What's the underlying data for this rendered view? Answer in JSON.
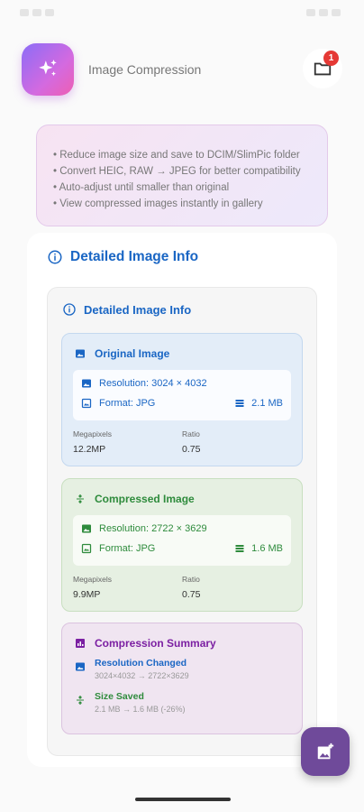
{
  "app": {
    "title": "Image Compression",
    "badge_count": "1"
  },
  "tips": [
    "• Reduce image size and save to DCIM/SlimPic folder",
    "• Convert HEIC, RAW → JPEG for better compatibility",
    "• Auto-adjust until smaller than original",
    "• View compressed images instantly in gallery"
  ],
  "outer": {
    "title": "Detailed Image Info"
  },
  "inner": {
    "title": "Detailed Image Info"
  },
  "original": {
    "title": "Original Image",
    "resolution": "Resolution: 3024 × 4032",
    "format": "Format: JPG",
    "size": "2.1 MB",
    "megapixels_label": "Megapixels",
    "megapixels": "12.2MP",
    "ratio_label": "Ratio",
    "ratio": "0.75"
  },
  "compressed": {
    "title": "Compressed Image",
    "resolution": "Resolution: 2722 × 3629",
    "format": "Format: JPG",
    "size": "1.6 MB",
    "megapixels_label": "Megapixels",
    "megapixels": "9.9MP",
    "ratio_label": "Ratio",
    "ratio": "0.75"
  },
  "summary": {
    "title": "Compression Summary",
    "resolution_label": "Resolution Changed",
    "resolution_detail": "3024×4032 → 2722×3629",
    "size_label": "Size Saved",
    "size_detail": "2.1 MB → 1.6 MB (-26%)"
  },
  "colors": {
    "blue": "#1a66c4",
    "green": "#2e8b3c",
    "purple": "#7b1fa2",
    "fab": "#6f4a9a"
  }
}
